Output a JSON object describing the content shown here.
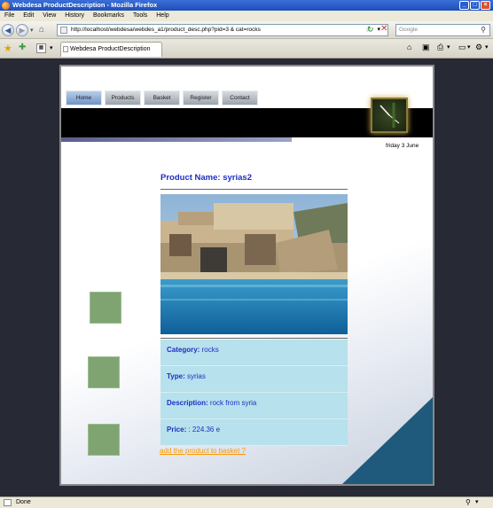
{
  "window": {
    "title": "Webdesa ProductDescription - Mozilla Firefox"
  },
  "menu": [
    "File",
    "Edit",
    "View",
    "History",
    "Bookmarks",
    "Tools",
    "Help"
  ],
  "toolbar": {
    "url": "http://localhost/webdesa/webdes_a1/product_desc.php?pid=3 & cat=rocks",
    "search_placeholder": "Google"
  },
  "tab": {
    "label": "Webdesa ProductDescription"
  },
  "site": {
    "nav": [
      "Home",
      "Products",
      "Basket",
      "Register",
      "Contact"
    ],
    "date": "friday 3 June"
  },
  "product": {
    "name_label": "Product Name:",
    "name": "syrias2",
    "category_label": "Category:",
    "category": "rocks",
    "type_label": "Type:",
    "type": "syrias",
    "description_label": "Description:",
    "description": "rock from syria",
    "price_label": "Price:",
    "price": ": 224.36 e",
    "basket_link": "add the product to basket ?"
  },
  "status": {
    "text": "Done"
  },
  "colors": {
    "title_blue": "#1f2ec5",
    "info_bg": "#b7e1ec",
    "link_orange": "#ff9900"
  }
}
